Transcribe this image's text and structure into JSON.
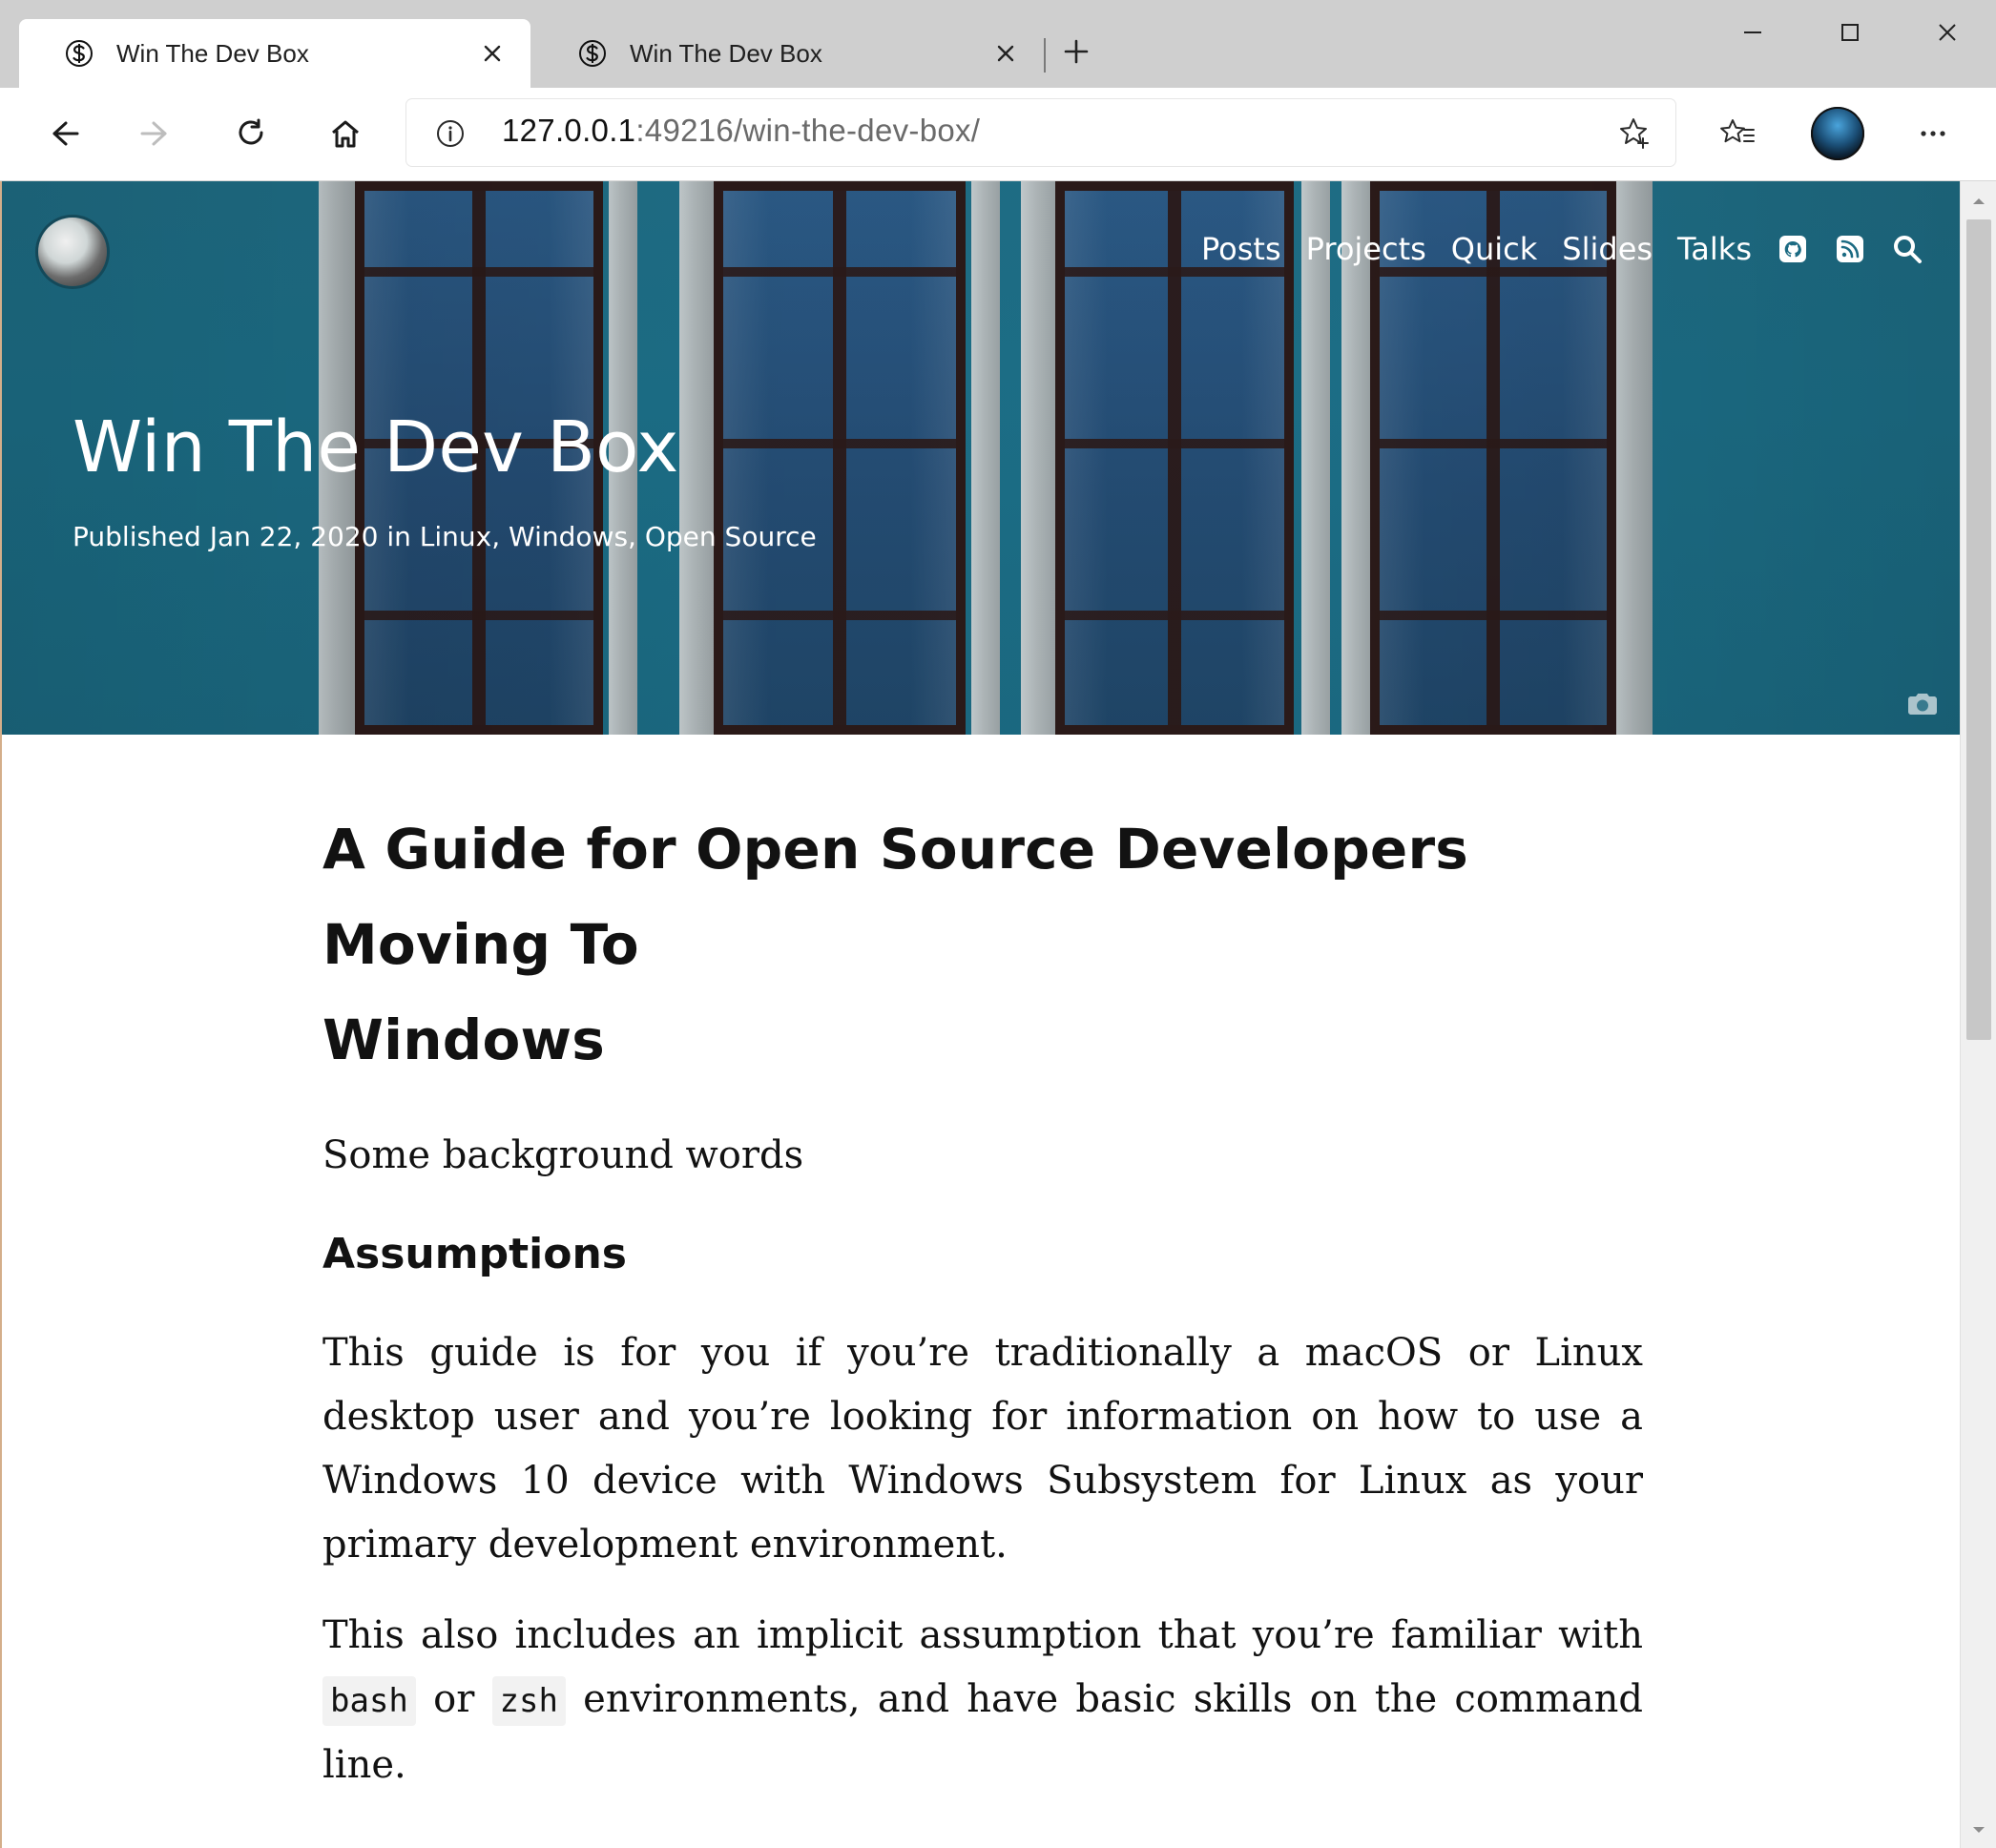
{
  "browser": {
    "tabs": [
      {
        "title": "Win The Dev Box",
        "active": true
      },
      {
        "title": "Win The Dev Box",
        "active": false
      }
    ],
    "address": {
      "url_host": "127.0.0.1",
      "url_rest": ":49216/win-the-dev-box/"
    },
    "icons": {
      "tab_icon": "site-icon",
      "close": "close-icon",
      "new_tab": "plus-icon",
      "minimize": "minimize-icon",
      "maximize": "maximize-icon",
      "window_close": "window-close-icon",
      "back": "back-arrow-icon",
      "forward": "forward-arrow-icon",
      "refresh": "refresh-icon",
      "home": "home-icon",
      "info": "info-icon",
      "favorite": "star-plus-icon",
      "collections": "favorites-list-icon",
      "profile": "profile-avatar",
      "more": "more-icon"
    }
  },
  "site": {
    "nav": {
      "links": [
        "Posts",
        "Projects",
        "Quick",
        "Slides",
        "Talks"
      ],
      "icons": [
        "github-icon",
        "rss-icon",
        "search-icon"
      ]
    },
    "hero": {
      "title": "Win The Dev Box",
      "meta": {
        "prefix": "Published Jan 22, 2020 in ",
        "categories": [
          "Linux",
          "Windows",
          "Open Source"
        ],
        "sep": ", "
      },
      "camera_icon": "camera-icon"
    },
    "article": {
      "title_line1": "A Guide for Open Source Developers Moving To",
      "title_line2": "Windows",
      "p1": "Some background words",
      "h2_assumptions": "Assumptions",
      "p2": "This guide is for you if you’re traditionally a macOS or Linux desktop user and you’re looking for information on how to use a Windows 10 device with Windows Subsystem for Linux as your primary development environment.",
      "p3_parts": {
        "before": "This also includes an implicit assumption that you’re familiar with ",
        "code1": "bash",
        "mid": " or ",
        "code2": "zsh",
        "after": " environments, and have basic skills on the command line."
      }
    }
  }
}
